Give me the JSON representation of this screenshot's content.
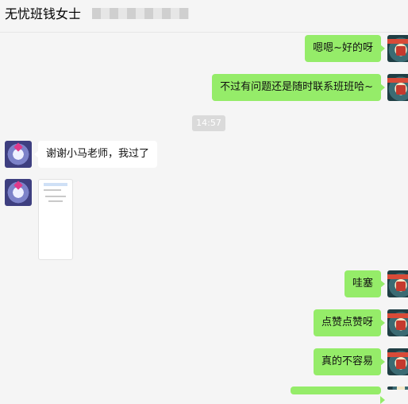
{
  "chat": {
    "title": "无忧班钱女士"
  },
  "messages": [
    {
      "from": "self",
      "text": "嗯嗯~好的呀"
    },
    {
      "from": "self",
      "text": "不过有问题还是随时联系班班哈~"
    },
    {
      "timestamp": "14:57"
    },
    {
      "from": "other",
      "text": "谢谢小马老师，我过了"
    },
    {
      "from": "other",
      "type": "image"
    },
    {
      "from": "self",
      "text": "哇塞"
    },
    {
      "from": "self",
      "text": "点赞点赞呀"
    },
    {
      "from": "self",
      "text": "真的不容易"
    }
  ],
  "colors": {
    "self_bubble": "#95ec69",
    "other_bubble": "#ffffff",
    "background": "#f5f5f5",
    "timestamp_bg": "#dadada"
  }
}
